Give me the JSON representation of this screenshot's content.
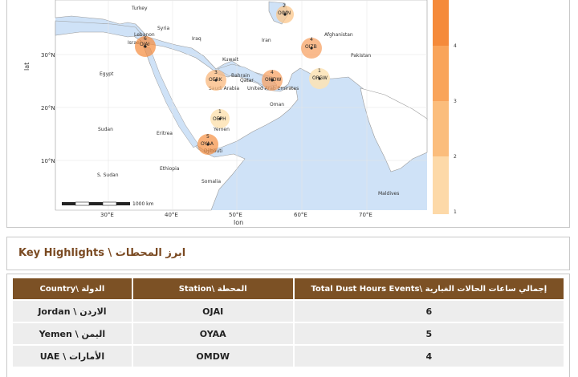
{
  "map": {
    "axis": {
      "y_label": "lat",
      "x_label": "lon",
      "lat_ticks": [
        "30°N",
        "20°N",
        "10°N"
      ],
      "lon_ticks": [
        "30°E",
        "40°E",
        "50°E",
        "60°E",
        "70°E"
      ]
    },
    "scale_bar": "1000 km",
    "countries": [
      "Turkey",
      "Syria",
      "Lebanon",
      "Israel",
      "Iraq",
      "Iran",
      "Afghanistan",
      "Pakistan",
      "Egypt",
      "Kuwait",
      "Bahrain",
      "Qatar",
      "Saudi Arabia",
      "United Arab Emirates",
      "Oman",
      "Sudan",
      "Eritrea",
      "Yemen",
      "Djibouti",
      "S. Sudan",
      "Ethiopia",
      "Somalia",
      "Maldives"
    ],
    "stations": [
      {
        "code": "OIMN",
        "count": "2"
      },
      {
        "code": "OJAI",
        "count": "6"
      },
      {
        "code": "OIZB",
        "count": "4"
      },
      {
        "code": "OERK",
        "count": "3"
      },
      {
        "code": "OMDW",
        "count": "4"
      },
      {
        "code": "OPGW",
        "count": "1"
      },
      {
        "code": "OEPH",
        "count": "1"
      },
      {
        "code": "OYAA",
        "count": "5"
      }
    ],
    "legend": {
      "ticks": [
        "4",
        "3",
        "2",
        "1"
      ],
      "colors": [
        "#f58a3a",
        "#f9a45a",
        "#fbbd7c",
        "#fdd9a8",
        "#fde9c4"
      ]
    }
  },
  "highlights": {
    "title": "Key Highlights \\ ابرز المحطات"
  },
  "table": {
    "headers": [
      "Country\\ الدولة",
      "Station\\ المحطة",
      "Total Dust Hours Events\\ إجمالي ساعات الحالات الغبارية"
    ],
    "rows": [
      {
        "country": "Jordan \\ الاردن",
        "station": "OJAI",
        "total": "6"
      },
      {
        "country": "Yemen \\ اليمن",
        "station": "OYAA",
        "total": "5"
      },
      {
        "country": "UAE \\ الأمارات",
        "station": "OMDW",
        "total": "4"
      }
    ],
    "colors": {
      "header_bg": "#7c5125",
      "row_bg": "#ededed",
      "title": "#7a4a22"
    }
  }
}
